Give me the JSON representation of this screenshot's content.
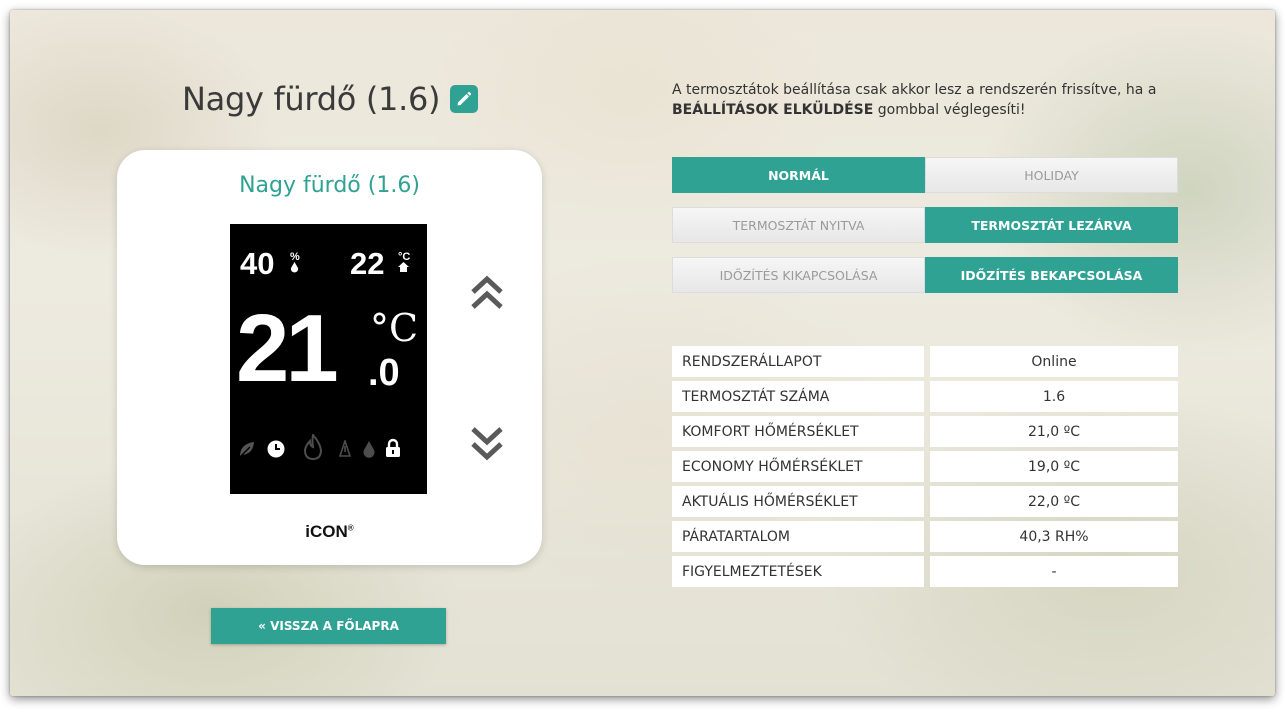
{
  "page": {
    "title": "Nagy fürdő (1.6)"
  },
  "thermostat": {
    "card_title": "Nagy fürdő (1.6)",
    "humidity": "40",
    "humidity_unit": "%",
    "target_temp": "22",
    "target_unit": "°C",
    "current_temp_int": "21",
    "current_temp_unit": "°C",
    "current_temp_dec": ".0",
    "brand": "iCON",
    "brand_mark": "®",
    "status_icons": [
      "leaf-icon",
      "clock-icon",
      "flame-icon",
      "weather-icon",
      "droplet-icon",
      "lock-icon"
    ]
  },
  "notice": {
    "part1": "A termosztátok beállítása csak akkor lesz a rendszerén frissítve, ha a ",
    "bold": "BEÁLLÍTÁSOK ELKÜLDÉSE",
    "part2": " gombbal véglegesíti!"
  },
  "modes": {
    "normal": "NORMÁL",
    "holiday": "HOLIDAY",
    "unlocked": "TERMOSZTÁT NYITVA",
    "locked": "TERMOSZTÁT LEZÁRVA",
    "timer_off": "IDŐZÍTÉS KIKAPCSOLÁSA",
    "timer_on": "IDŐZÍTÉS BEKAPCSOLÁSA"
  },
  "info_rows": [
    {
      "label": "RENDSZERÁLLAPOT",
      "value": "Online"
    },
    {
      "label": "TERMOSZTÁT SZÁMA",
      "value": "1.6"
    },
    {
      "label": "KOMFORT HŐMÉRSÉKLET",
      "value": "21,0 ºC"
    },
    {
      "label": "ECONOMY HŐMÉRSÉKLET",
      "value": "19,0 ºC"
    },
    {
      "label": "AKTUÁLIS HŐMÉRSÉKLET",
      "value": "22,0 ºC"
    },
    {
      "label": "PÁRATARTALOM",
      "value": "40,3 RH%"
    },
    {
      "label": "FIGYELMEZTETÉSEK",
      "value": "-"
    }
  ],
  "back_button": "« VISSZA A FŐLAPRA",
  "colors": {
    "accent": "#2fa294"
  }
}
